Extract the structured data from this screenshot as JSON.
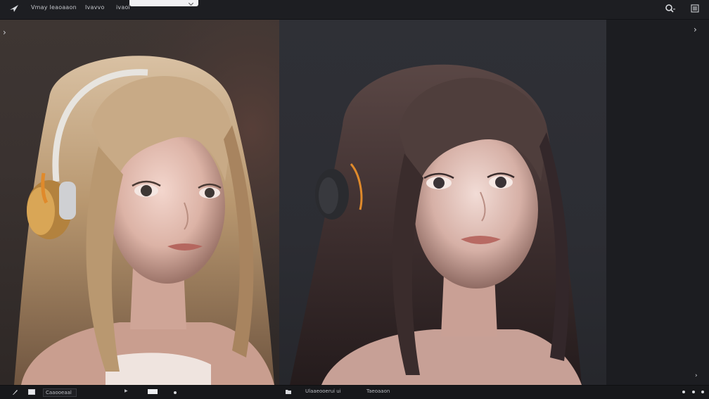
{
  "topbar": {
    "menu": [
      "Vmay Ieaoaaon",
      "Ivavvo",
      "ivaoi"
    ],
    "search_placeholder": ""
  },
  "bottombar": {
    "field_text": "Caaooeaal",
    "status_left": "Ulaaeooerui ui",
    "status_right": "Taeoaaon"
  },
  "colors": {
    "accent_orange": "#e08a2b",
    "left_bg": "#3c3431",
    "mid_bg": "#2e2f35"
  },
  "icons": [
    "app-logo-icon",
    "search-icon",
    "hamburger-menu-icon",
    "chevron-right-icon",
    "chevron-right-icon",
    "pen-icon",
    "square-icon",
    "folder-icon",
    "info-icon",
    "settings-icon"
  ]
}
